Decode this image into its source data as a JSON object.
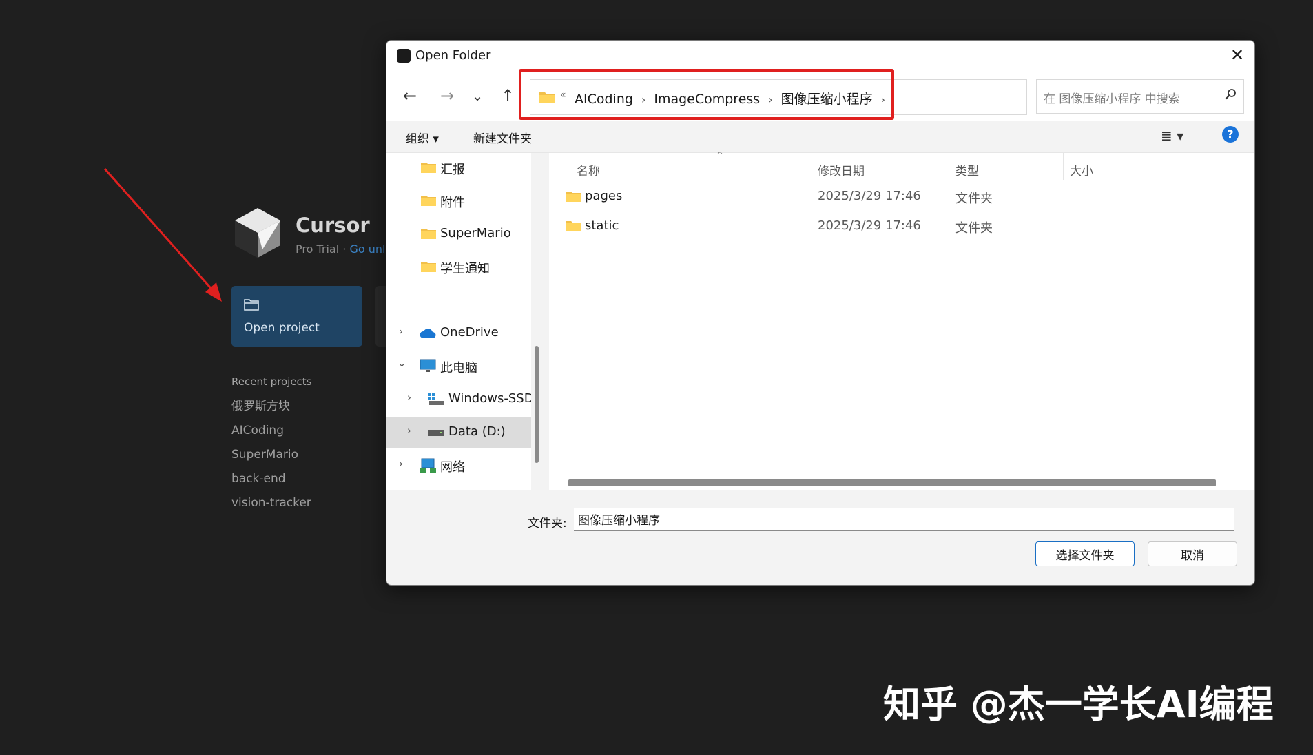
{
  "welcome": {
    "app_name": "Cursor",
    "plan": "Pro Trial",
    "dot": "·",
    "upgrade_link": "Go unl",
    "open_project_label": "Open project",
    "recent_title": "Recent projects",
    "recent_projects": [
      "俄罗斯方块",
      "AICoding",
      "SuperMario",
      "back-end",
      "vision-tracker"
    ]
  },
  "dialog": {
    "title": "Open Folder",
    "close": "✕",
    "nav": {
      "back": "←",
      "forward": "→",
      "recent": "⌄",
      "up": "↑"
    },
    "breadcrumb": {
      "overflow": "«",
      "items": [
        "AICoding",
        "ImageCompress",
        "图像压缩小程序"
      ],
      "separator": "›"
    },
    "search_placeholder": "在 图像压缩小程序 中搜索",
    "commands": {
      "organize": "组织 ▾",
      "new_folder": "新建文件夹",
      "view": "≣ ▾",
      "help": "?"
    },
    "tree": {
      "quick_access": [
        "汇报",
        "附件",
        "SuperMario",
        "学生通知"
      ],
      "onedrive": "OneDrive",
      "this_pc": "此电脑",
      "drives": [
        "Windows-SSD",
        "Data (D:)"
      ],
      "network": "网络"
    },
    "columns": {
      "name": "名称",
      "modified": "修改日期",
      "type": "类型",
      "size": "大小"
    },
    "files": [
      {
        "name": "pages",
        "modified": "2025/3/29 17:46",
        "type": "文件夹"
      },
      {
        "name": "static",
        "modified": "2025/3/29 17:46",
        "type": "文件夹"
      }
    ],
    "folder_label": "文件夹:",
    "folder_value": "图像压缩小程序",
    "select_button": "选择文件夹",
    "cancel_button": "取消"
  },
  "watermark": "知乎 @杰一学长AI编程",
  "colors": {
    "annotation_red": "#e0201f",
    "accent_blue": "#1a73d9",
    "project_card": "#1f4464"
  }
}
